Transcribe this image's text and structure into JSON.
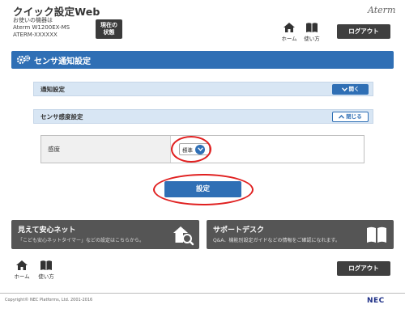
{
  "header": {
    "app_title": "クイック設定Web",
    "device_line1": "お使いの機器は",
    "device_line2": "Aterm W1200EX-MS",
    "device_line3": "ATERM-XXXXXX",
    "status_line1": "現在の",
    "status_line2": "状態",
    "brand": "Aterm",
    "home_label": "ホーム",
    "howto_label": "使い方",
    "logout_label": "ログアウト"
  },
  "page": {
    "title": "センサ通知設定"
  },
  "sections": {
    "notify": {
      "label": "通知設定",
      "toggle_label": "開く"
    },
    "sensitivity": {
      "label": "センサ感度設定",
      "toggle_label": "閉じる"
    }
  },
  "form": {
    "sensitivity_label": "感度",
    "sensitivity_value": "標準",
    "submit_label": "設定"
  },
  "banners": {
    "left": {
      "title": "見えて安心ネット",
      "desc": "「こども安心ネットタイマー」などの設定はこちらから。"
    },
    "right": {
      "title": "サポートデスク",
      "desc": "Q&A、機能別設定ガイドなどの情報をご確認になれます。"
    }
  },
  "footer": {
    "home_label": "ホーム",
    "howto_label": "使い方",
    "logout_label": "ログアウト",
    "copyright": "Copyright© NEC Platforms, Ltd. 2001-2016",
    "logo": "NEC"
  },
  "colors": {
    "accent": "#2f6fb5",
    "panel_bar": "#d8e6f4",
    "highlight": "#e02020",
    "dark_button": "#3f3f3f"
  }
}
